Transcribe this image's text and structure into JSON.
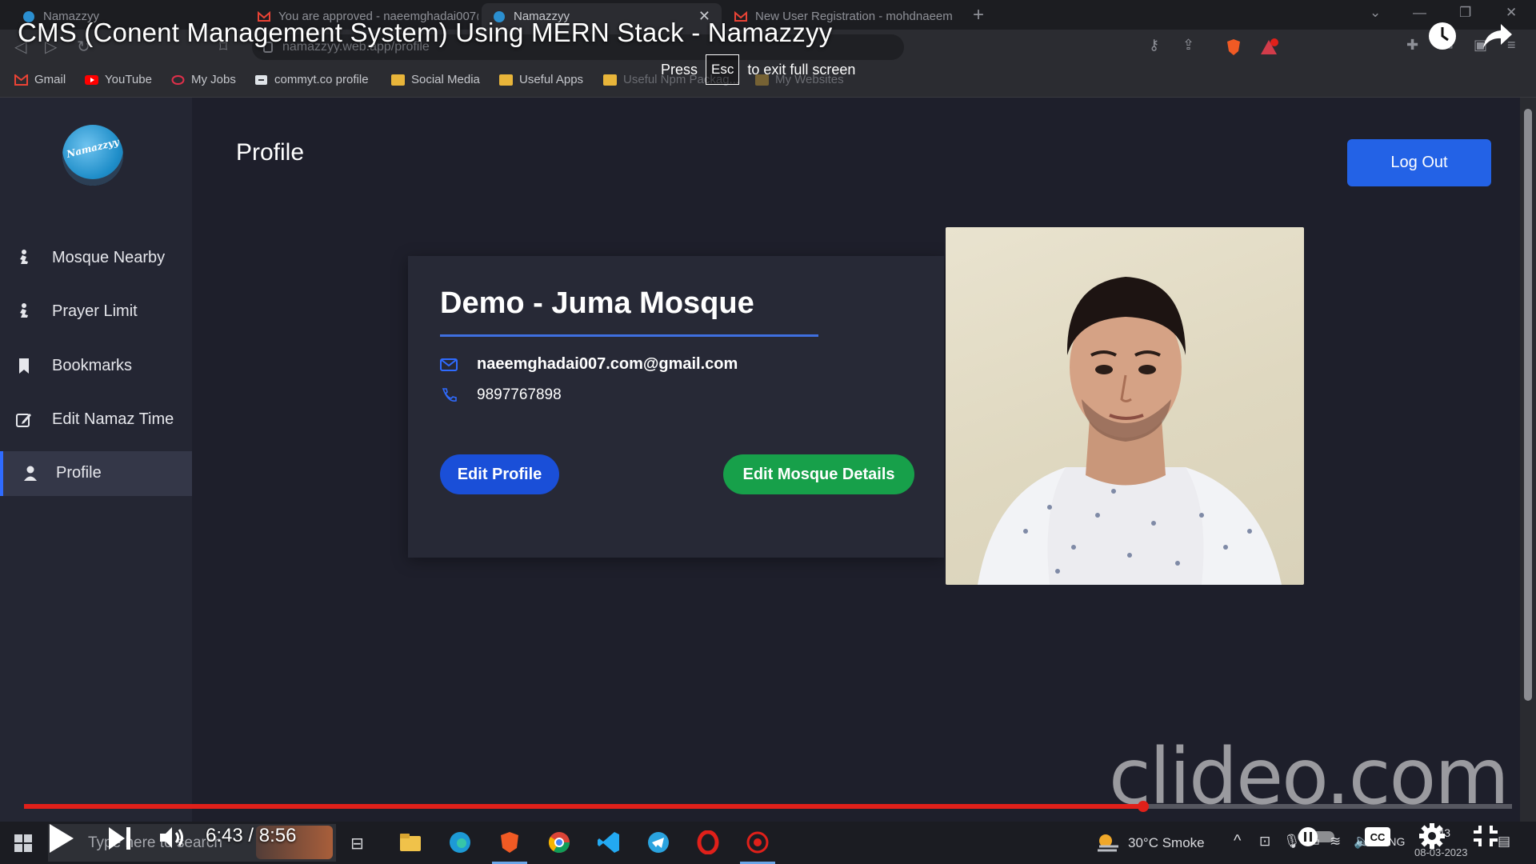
{
  "browser": {
    "tabs": [
      {
        "label": "Namazzyy",
        "active": false
      },
      {
        "label": "You are approved - naeemghadai007@",
        "active": false
      },
      {
        "label": "Namazzyy",
        "active": true
      },
      {
        "label": "New User Registration - mohdnaeem",
        "active": false
      }
    ],
    "address": "namazzyy.web.app/profile",
    "bookmarks": [
      {
        "label": "Gmail",
        "icon": "gmail-icon"
      },
      {
        "label": "YouTube",
        "icon": "youtube-icon"
      },
      {
        "label": "My Jobs",
        "icon": "ring-icon"
      },
      {
        "label": "commyt.co profile",
        "icon": "link-icon"
      },
      {
        "label": "Social Media",
        "icon": "folder-icon"
      },
      {
        "label": "Useful Apps",
        "icon": "folder-icon"
      },
      {
        "label": "Useful Npm Packag...",
        "icon": "folder-icon"
      },
      {
        "label": "My Websites",
        "icon": "folder-icon"
      }
    ]
  },
  "video": {
    "title": "CMS (Conent Management System) Using MERN Stack - Namazzyy",
    "fullscreen_notice": {
      "press": "Press",
      "key": "Esc",
      "rest": "to exit full screen"
    },
    "time": "6:43 / 8:56",
    "progress": 0.752,
    "watermark": "clideo.com"
  },
  "app": {
    "logo_text": "Namazzyy",
    "page_title": "Profile",
    "logout_label": "Log Out",
    "nav": [
      {
        "label": "Mosque Nearby",
        "icon": "prayer-icon",
        "active": false
      },
      {
        "label": "Prayer Limit",
        "icon": "prayer-icon",
        "active": false
      },
      {
        "label": "Bookmarks",
        "icon": "bookmark-icon",
        "active": false
      },
      {
        "label": "Edit Namaz Time",
        "icon": "edit-icon",
        "active": false
      },
      {
        "label": "Profile",
        "icon": "person-icon",
        "active": true
      }
    ],
    "profile": {
      "mosque_name": "Demo - Juma Mosque",
      "email": "naeemghadai007.com@gmail.com",
      "phone": "9897767898",
      "edit_profile_label": "Edit Profile",
      "edit_mosque_label": "Edit Mosque Details"
    }
  },
  "taskbar": {
    "search_placeholder": "Type here to search",
    "weather": "30°C  Smoke",
    "language": "ENG",
    "clock": "14:43",
    "date": "08-03-2023"
  },
  "colors": {
    "background": "#1e1f2b",
    "sidebar": "#242633",
    "primary": "#2362e6",
    "success": "#17a04a",
    "progress": "#e0201a"
  }
}
